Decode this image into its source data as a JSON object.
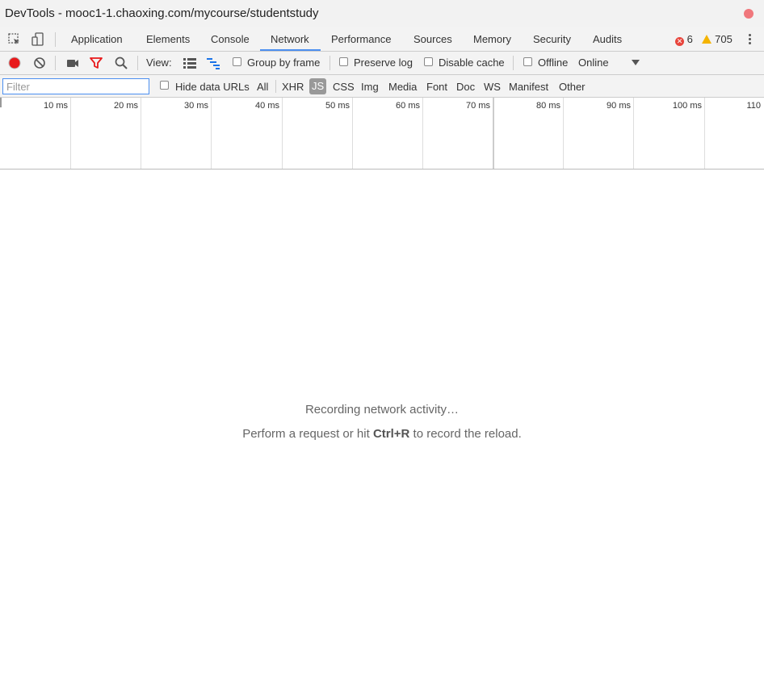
{
  "window": {
    "title": "DevTools - mooc1-1.chaoxing.com/mycourse/studentstudy"
  },
  "tabs": [
    {
      "label": "Application"
    },
    {
      "label": "Elements"
    },
    {
      "label": "Console"
    },
    {
      "label": "Network",
      "active": true
    },
    {
      "label": "Performance"
    },
    {
      "label": "Sources"
    },
    {
      "label": "Memory"
    },
    {
      "label": "Security"
    },
    {
      "label": "Audits"
    }
  ],
  "status": {
    "errors": "6",
    "warnings": "705"
  },
  "toolbar": {
    "view_label": "View:",
    "group_by_frame": "Group by frame",
    "preserve_log": "Preserve log",
    "disable_cache": "Disable cache",
    "offline": "Offline",
    "throttle": "Online"
  },
  "filterbar": {
    "placeholder": "Filter",
    "hide_data_urls": "Hide data URLs",
    "types": [
      "All",
      "XHR",
      "JS",
      "CSS",
      "Img",
      "Media",
      "Font",
      "Doc",
      "WS",
      "Manifest",
      "Other"
    ],
    "active_type": "JS"
  },
  "timeline": {
    "ticks": [
      "10 ms",
      "20 ms",
      "30 ms",
      "40 ms",
      "50 ms",
      "60 ms",
      "70 ms",
      "80 ms",
      "90 ms",
      "100 ms",
      "110"
    ]
  },
  "empty_state": {
    "line1": "Recording network activity…",
    "line2_pre": "Perform a request or hit ",
    "line2_key": "Ctrl+R",
    "line2_post": " to record the reload."
  },
  "colors": {
    "accent": "#1a73e8",
    "record": "#e8191b",
    "filter_icon": "#e8191b",
    "active_filter_bg": "#999999"
  }
}
